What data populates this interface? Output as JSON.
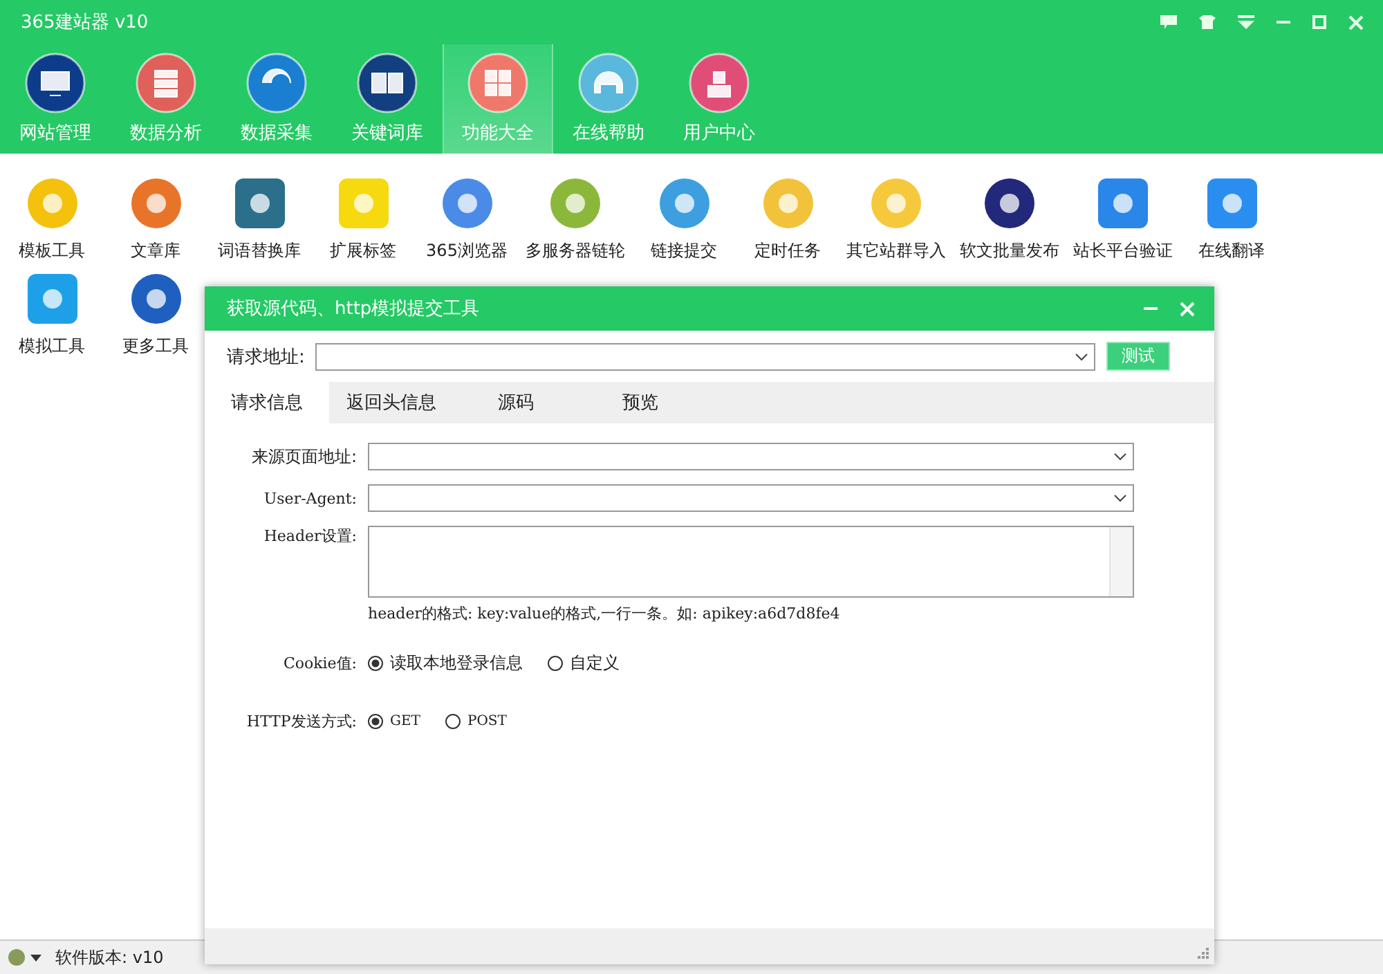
{
  "window": {
    "title": "365建站器 v10"
  },
  "nav": [
    {
      "label": "网站管理",
      "selected": false
    },
    {
      "label": "数据分析",
      "selected": false
    },
    {
      "label": "数据采集",
      "selected": false
    },
    {
      "label": "关键词库",
      "selected": false
    },
    {
      "label": "功能大全",
      "selected": true
    },
    {
      "label": "在线帮助",
      "selected": false
    },
    {
      "label": "用户中心",
      "selected": false
    }
  ],
  "tool_rows": [
    [
      "模板工具",
      "文章库",
      "词语替换库",
      "扩展标签",
      "365浏览器",
      "多服务器链轮",
      "链接提交",
      "定时任务",
      "其它站群导入",
      "软文批量发布",
      "站长平台验证",
      "在线翻译"
    ],
    [
      "模拟工具",
      "更多工具"
    ]
  ],
  "dialog": {
    "title": "获取源代码、http模拟提交工具",
    "url_label": "请求地址:",
    "test_button": "测试",
    "tabs": [
      {
        "label": "请求信息",
        "selected": true
      },
      {
        "label": "返回头信息",
        "selected": false
      },
      {
        "label": "源码",
        "selected": false
      },
      {
        "label": "预览",
        "selected": false
      }
    ],
    "referer_label": "来源页面地址:",
    "ua_label": "User-Agent:",
    "header_label": "Header设置:",
    "header_hint": "header的格式: key:value的格式,一行一条。如: apikey:a6d7d8fe4",
    "cookie_label": "Cookie值:",
    "cookie_options": [
      {
        "label": "读取本地登录信息",
        "selected": true
      },
      {
        "label": "自定义",
        "selected": false
      }
    ],
    "method_label": "HTTP发送方式:",
    "method_options": [
      {
        "label": "GET",
        "selected": true
      },
      {
        "label": "POST",
        "selected": false
      }
    ]
  },
  "status_bar": {
    "version": "软件版本: v10"
  }
}
